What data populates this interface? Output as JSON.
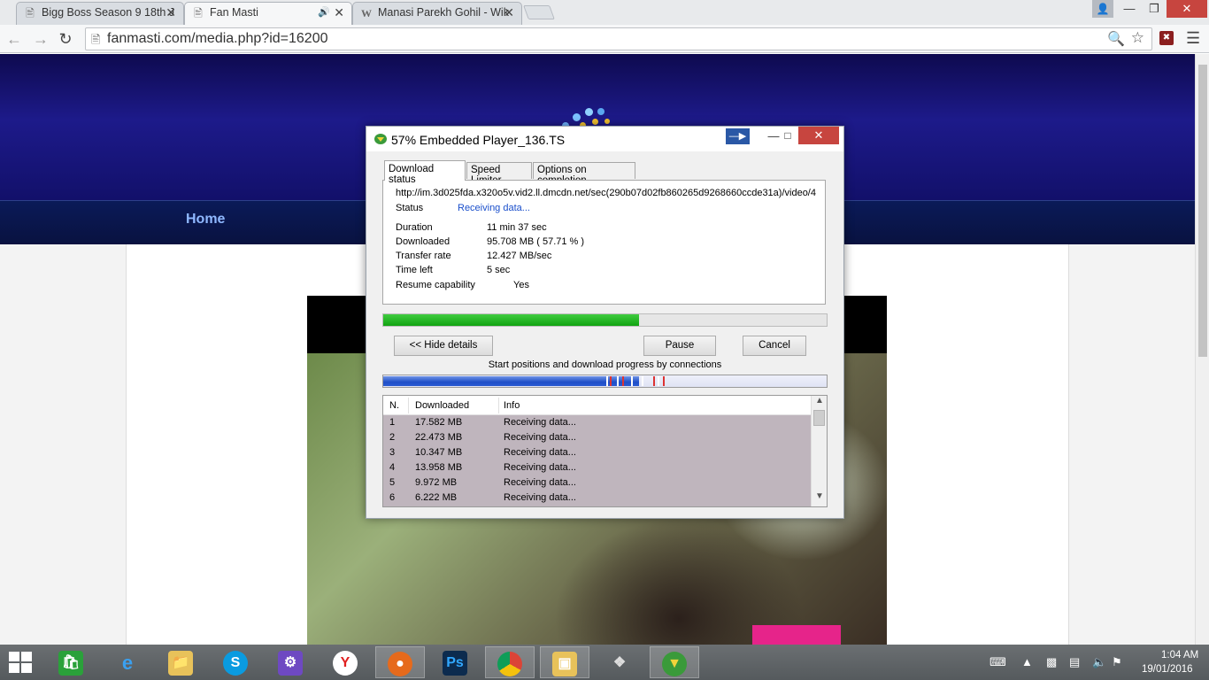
{
  "browser": {
    "tabs": [
      {
        "title": "Bigg Boss Season 9 18th J",
        "icon": "page-icon",
        "active": false
      },
      {
        "title": "Fan Masti",
        "icon": "page-icon",
        "active": true,
        "audio_icon": "speaker-icon"
      },
      {
        "title": "Manasi Parekh Gohil - Wik",
        "icon": "wikipedia-icon",
        "active": false
      }
    ],
    "url": "fanmasti.com/media.php?id=16200"
  },
  "site": {
    "nav": {
      "home_label": "Home"
    }
  },
  "download_dialog": {
    "title": "57% Embedded Player_136.TS",
    "tabs": [
      "Download status",
      "Speed Limiter",
      "Options on completion"
    ],
    "active_tab": "Download status",
    "url": "http://im.3d025fda.x320o5v.vid2.ll.dmcdn.net/sec(290b07d02fb860265d9268660ccde31a)/video/4",
    "status_label": "Status",
    "status_value": "Receiving data...",
    "details": [
      {
        "label": "Duration",
        "value": "11 min 37 sec"
      },
      {
        "label": "Downloaded",
        "value": "95.708  MB  ( 57.71 % )"
      },
      {
        "label": "Transfer rate",
        "value": "12.427  MB/sec"
      },
      {
        "label": "Time left",
        "value": "5 sec"
      }
    ],
    "resume_label": "Resume capability",
    "resume_value": "Yes",
    "progress_percent": 57.71,
    "buttons": {
      "hide_details": "<< Hide details",
      "pause": "Pause",
      "cancel": "Cancel"
    },
    "connections_label": "Start positions and download progress by connections",
    "connections_columns": [
      "N.",
      "Downloaded",
      "Info"
    ],
    "connections": [
      {
        "n": "1",
        "downloaded": "17.582  MB",
        "info": "Receiving data..."
      },
      {
        "n": "2",
        "downloaded": "22.473  MB",
        "info": "Receiving data..."
      },
      {
        "n": "3",
        "downloaded": "10.347  MB",
        "info": "Receiving data..."
      },
      {
        "n": "4",
        "downloaded": "13.958  MB",
        "info": "Receiving data..."
      },
      {
        "n": "5",
        "downloaded": "9.972  MB",
        "info": "Receiving data..."
      },
      {
        "n": "6",
        "downloaded": "6.222  MB",
        "info": "Receiving data..."
      }
    ]
  },
  "taskbar": {
    "apps": [
      "store-icon",
      "internet-explorer-icon",
      "file-explorer-icon",
      "skype-icon",
      "settings-icon",
      "yandex-icon",
      "firefox-icon",
      "photoshop-icon",
      "chrome-icon",
      "media-center-icon",
      "system-tool-icon",
      "idm-icon"
    ],
    "time": "1:04 AM",
    "date": "19/01/2016"
  }
}
